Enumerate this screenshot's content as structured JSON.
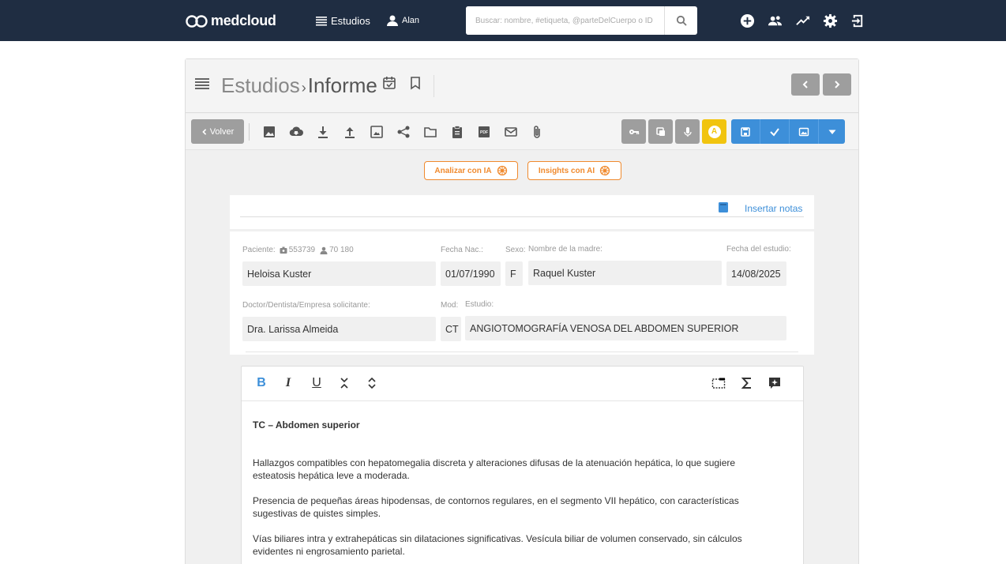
{
  "app": {
    "name": "medcloud"
  },
  "nav": {
    "studies_label": "Estudios",
    "user_label": "Alan",
    "search_placeholder": "Buscar: nombre, #etiqueta, @parteDelCuerpo o ID",
    "icons": [
      "add-circle-icon",
      "users-icon",
      "trending-icon",
      "settings-icon",
      "logout-icon"
    ]
  },
  "header": {
    "breadcrumb_root": "Estudios",
    "breadcrumb_separator": "›",
    "breadcrumb_current": "Informe"
  },
  "toolbar": {
    "back_label": "Volver",
    "icons": [
      "image-icon",
      "cloud-download-icon",
      "download-icon",
      "upload-icon",
      "photo-icon",
      "share-icon",
      "folder-icon",
      "clipboard-icon",
      "pdf-icon",
      "mail-icon",
      "attach-icon"
    ],
    "right_icons": [
      "key-icon",
      "copy-icon",
      "mic-icon"
    ],
    "ai_badge": "A",
    "action_icons": [
      "save-icon",
      "check-icon",
      "image-icon",
      "caret-down-icon"
    ]
  },
  "ai": {
    "analyze_label": "Analizar con IA",
    "insights_label": "Insights con AI"
  },
  "notes": {
    "insert_label": "Insertar notas"
  },
  "patient": {
    "label": "Paciente:",
    "id_number": "553739",
    "id_secondary": "70 180",
    "name": "Heloisa Kuster",
    "birth_label": "Fecha Nac.:",
    "birth_date": "01/07/1990",
    "sex_label": "Sexo:",
    "sex": "F",
    "mother_label": "Nombre de la madre:",
    "mother_name": "Raquel Kuster",
    "study_date_label": "Fecha del estudio:",
    "study_date": "14/08/2025",
    "doctor_label": "Doctor/Dentista/Empresa solicitante:",
    "doctor": "Dra. Larissa Almeida",
    "mod_label": "Mod:",
    "mod": "CT",
    "study_label": "Estudio:",
    "study": "ANGIOTOMOGRAFÍA VENOSA DEL ABDOMEN SUPERIOR"
  },
  "editor": {
    "bold_label": "B",
    "italic_label": "I",
    "underline_label": "U",
    "title": "TC – Abdomen superior",
    "paragraphs": [
      "Hallazgos compatibles con hepatomegalia discreta y alteraciones difusas de la atenuación hepática, lo que sugiere esteatosis hepática leve a moderada.",
      "Presencia de pequeñas áreas hipodensas, de contornos regulares, en el segmento VII hepático, con características sugestivas de quistes simples.",
      "Vías biliares intra y extrahepáticas sin dilataciones significativas. Vesícula biliar de volumen conservado, sin cálculos evidentes ni engrosamiento parietal."
    ]
  },
  "colors": {
    "navbar": "#1f2d42",
    "accent_blue": "#3d8fd9",
    "ai_orange": "#f08a2e",
    "badge_yellow": "#f1c40f",
    "button_gray": "#9e9e9e"
  }
}
